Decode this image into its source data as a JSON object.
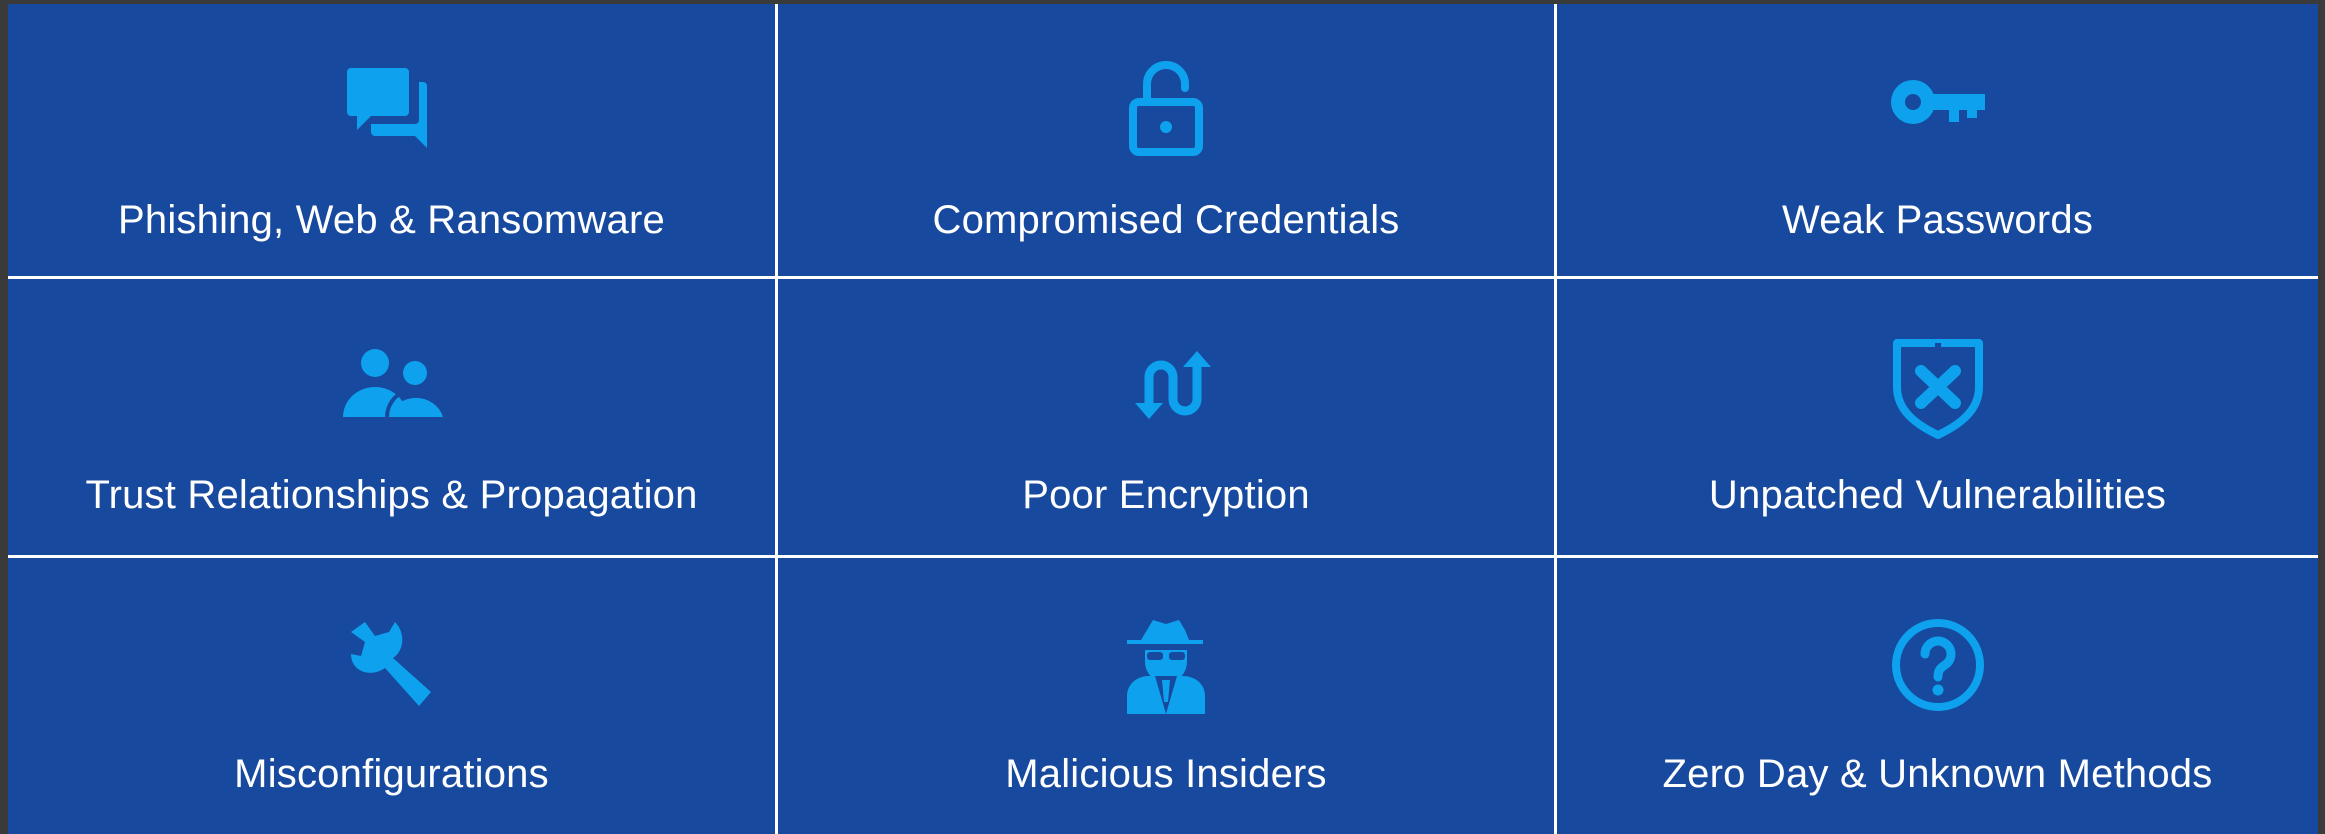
{
  "colors": {
    "tile_background": "#17499e",
    "icon": "#0ea1ee",
    "text": "#ffffff",
    "divider": "#ffffff",
    "outer_border": "#3a3a3a"
  },
  "tiles": [
    {
      "label": "Phishing, Web & Ransomware",
      "icon": "chat-bubbles-icon"
    },
    {
      "label": "Compromised Credentials",
      "icon": "unlocked-padlock-icon"
    },
    {
      "label": "Weak Passwords",
      "icon": "key-icon"
    },
    {
      "label": "Trust Relationships & Propagation",
      "icon": "people-icon"
    },
    {
      "label": "Poor Encryption",
      "icon": "flow-arrows-icon"
    },
    {
      "label": "Unpatched Vulnerabilities",
      "icon": "shield-x-icon"
    },
    {
      "label": "Misconfigurations",
      "icon": "wrench-icon"
    },
    {
      "label": "Malicious Insiders",
      "icon": "spy-icon"
    },
    {
      "label": "Zero Day & Unknown Methods",
      "icon": "question-circle-icon"
    }
  ]
}
